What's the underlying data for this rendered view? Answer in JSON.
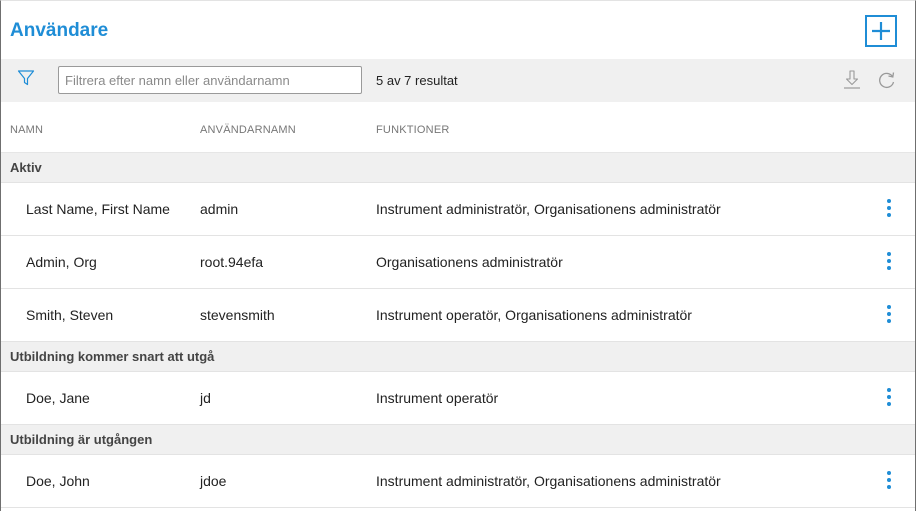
{
  "header": {
    "title": "Användare",
    "add_icon": "plus-icon",
    "accent": "#1f8dd6"
  },
  "toolbar": {
    "filter_icon": "filter-icon",
    "filter_placeholder": "Filtrera efter namn eller användarnamn",
    "filter_value": "",
    "result_count": "5 av 7 resultat",
    "download_icon": "download-icon",
    "refresh_icon": "refresh-icon"
  },
  "columns": [
    "NAMN",
    "ANVÄNDARNAMN",
    "FUNKTIONER"
  ],
  "groups": [
    {
      "label": "Aktiv",
      "rows": [
        {
          "name": "Last Name, First Name",
          "username": "admin",
          "functions": "Instrument administratör, Organisationens administratör"
        },
        {
          "name": "Admin, Org",
          "username": "root.94efa",
          "functions": "Organisationens administratör"
        },
        {
          "name": "Smith, Steven",
          "username": "stevensmith",
          "functions": "Instrument operatör, Organisationens administratör"
        }
      ]
    },
    {
      "label": "Utbildning kommer snart att utgå",
      "rows": [
        {
          "name": "Doe, Jane",
          "username": "jd",
          "functions": "Instrument operatör"
        }
      ]
    },
    {
      "label": "Utbildning är utgången",
      "rows": [
        {
          "name": "Doe, John",
          "username": "jdoe",
          "functions": "Instrument administratör, Organisationens administratör"
        }
      ]
    }
  ],
  "row_menu_icon": "more-vertical-icon"
}
